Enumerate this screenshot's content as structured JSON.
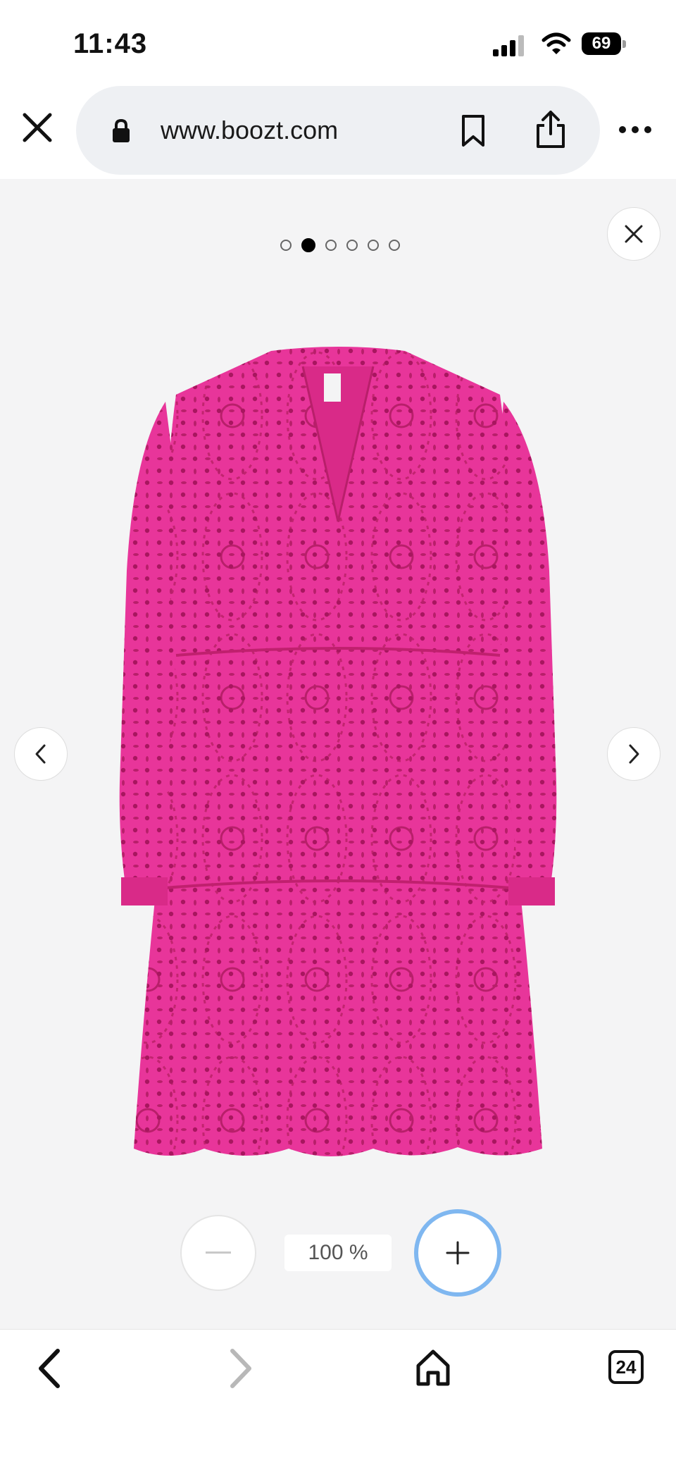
{
  "status_bar": {
    "time": "11:43",
    "battery": "69"
  },
  "browser": {
    "url": "www.boozt.com",
    "icons": [
      "close-icon",
      "lock-icon",
      "bookmark-icon",
      "share-icon",
      "more-icon"
    ]
  },
  "viewer": {
    "pagination": {
      "count": 6,
      "active_index": 1
    },
    "zoom_level": "100 %",
    "image_alt": "Pink eyelet lace tiered dress",
    "colors": {
      "background": "#f4f4f5",
      "dress": "#e8359a",
      "zoom_ring": "#7fb7f0"
    }
  },
  "toolbar": {
    "tab_count": "24",
    "icons": [
      "back-arrow-icon",
      "forward-arrow-icon",
      "home-icon",
      "tabs-icon"
    ]
  }
}
